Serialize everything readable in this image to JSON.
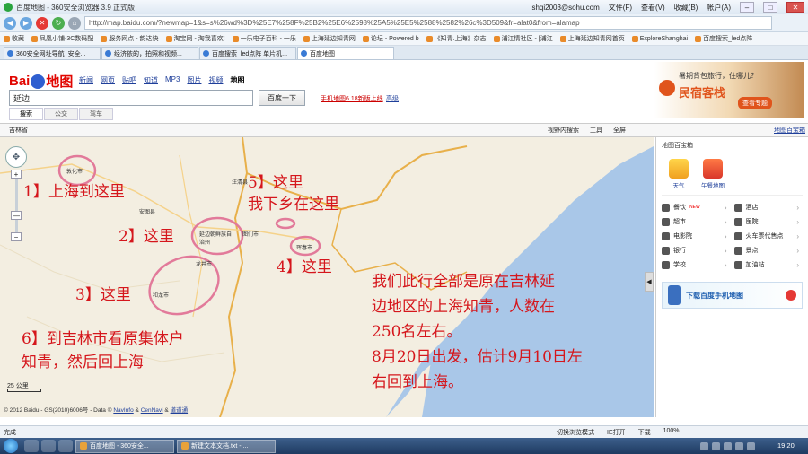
{
  "browser": {
    "title": "百度地图 - 360安全浏览器 3.9 正式版",
    "user": "shqi2003@sohu.com",
    "menus": [
      "文件(F)",
      "查看(V)",
      "收藏(B)",
      "帐户(A)"
    ],
    "url": "http://map.baidu.com/?newmap=1&s=s%26wd%3D%25E7%258F%25B2%25E6%2598%25A5%25E5%2588%2582%26c%3D509&fr=alat0&from=alamap"
  },
  "favorites": [
    "收藏",
    "凤凰小铺-3C数码配",
    "服务网点 - 韵达快",
    "淘宝网 - 淘我喜欢!",
    "一乐电子百科 - 一乐",
    "上海延边知青网",
    "论坛 - Powered b",
    "《知青.上海》杂志",
    "浦江情社区 - [浦江",
    "上海延边知青网首页",
    "ExploreShanghai",
    "百度搜索_led点阵"
  ],
  "tabs": [
    "360安全网址导航_安全...",
    "经济依的，拍照和视频...",
    "百度搜索_led点阵 单片机...",
    "百度地图"
  ],
  "baidu": {
    "logo": "Bai地图",
    "nav": [
      "新闻",
      "网页",
      "贴吧",
      "知道",
      "MP3",
      "图片",
      "视频",
      "地图"
    ],
    "search_value": "延边",
    "search_button": "百度一下",
    "promo": "手机地图6.18新版上线",
    "advanced": "高级",
    "subtabs": [
      "搜索",
      "公交",
      "驾车"
    ],
    "ad_line1": "暑期背包旅行，住哪儿？",
    "ad_line2": "民宿客栈",
    "ad_button": "查看专题"
  },
  "map_toolbar": {
    "region": "吉林省",
    "tools": [
      "视野内搜索",
      "工具",
      "全屏"
    ],
    "right_link": "地图百宝箱"
  },
  "map": {
    "places": [
      "敦化市",
      "安图县",
      "汪清县",
      "图们市",
      "延边朝鲜族自治州",
      "珲春市",
      "龙井市",
      "和龙市"
    ],
    "annotations": {
      "a1": "1】上海到这里",
      "a2": "2】这里",
      "a3": "3】这里",
      "a4": "4】这里",
      "a5_line1": "5】这里",
      "a5_line2": "我下乡在这里",
      "a6_line1": "6】到吉林市看原集体户",
      "a6_line2": "知青，然后回上海",
      "note_line1": "我们此行全部是原在吉林延",
      "note_line2": "边地区的上海知青，人数在",
      "note_line3": "250名左右。",
      "note_line4": "8月20日出发，估计9月10日左",
      "note_line5": "右回到上海。"
    },
    "scale": "25 公里",
    "copyright": "© 2012 Baidu - GS(2010)6006号 - Data ©",
    "copyright_links": [
      "NavInfo",
      "CenNavi",
      "道道通"
    ]
  },
  "sidebar": {
    "head": "地图百宝箱",
    "tools": [
      "天气",
      "午餐地图"
    ],
    "items": [
      "餐饮",
      "酒店",
      "超市",
      "医院",
      "电影院",
      "火车票代售点",
      "银行",
      "景点",
      "学校",
      "加油站"
    ],
    "hot_label": "NEW",
    "mobile_ad": "下载百度手机地图"
  },
  "statusbar": {
    "left": "完成",
    "right": [
      "切换浏览模式",
      "IE打开",
      "下载",
      "100%"
    ]
  },
  "taskbar": {
    "tasks": [
      "百度地图 - 360安全...",
      "新建文本文档.txt - ..."
    ],
    "time": "19:20"
  },
  "colors": {
    "annotation": "#d5161c",
    "sea": "#a9c7e8",
    "land": "#f3eee1",
    "border_road": "#e8b04a"
  }
}
